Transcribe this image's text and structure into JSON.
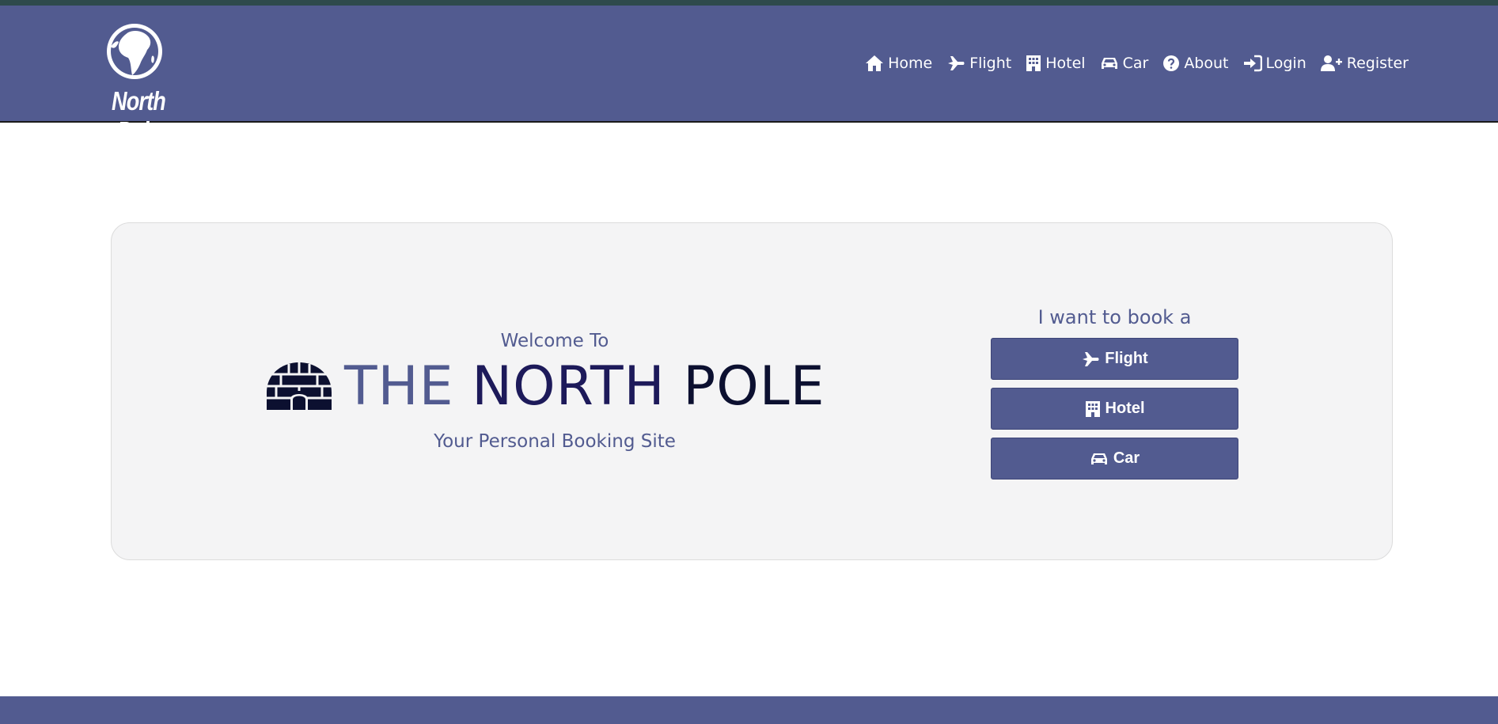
{
  "app": {
    "brand": "North Pole"
  },
  "nav": {
    "items": [
      {
        "label": "Home",
        "icon": "home-icon"
      },
      {
        "label": "Flight",
        "icon": "plane-icon"
      },
      {
        "label": "Hotel",
        "icon": "building-icon"
      },
      {
        "label": "Car",
        "icon": "car-icon"
      },
      {
        "label": "About",
        "icon": "question-circle-icon"
      },
      {
        "label": "Login",
        "icon": "sign-in-icon"
      },
      {
        "label": "Register",
        "icon": "user-plus-icon"
      }
    ]
  },
  "hero": {
    "welcome": "Welcome To",
    "title_the": "THE",
    "title_north": "NORTH",
    "title_pole": "POLE",
    "tagline": "Your Personal Booking Site",
    "icon": "igloo-icon"
  },
  "booking": {
    "label": "I want to book a",
    "buttons": [
      {
        "label": "Flight",
        "icon": "plane-icon"
      },
      {
        "label": "Hotel",
        "icon": "building-icon"
      },
      {
        "label": "Car",
        "icon": "car-icon"
      }
    ]
  },
  "colors": {
    "navbar": "#525b90",
    "topline": "#2e4a4c",
    "hero_bg": "#f4f4f5",
    "title_the": "#525b90",
    "title_north": "#1d1a5a",
    "title_pole": "#0c1030",
    "button": "#525b90"
  }
}
